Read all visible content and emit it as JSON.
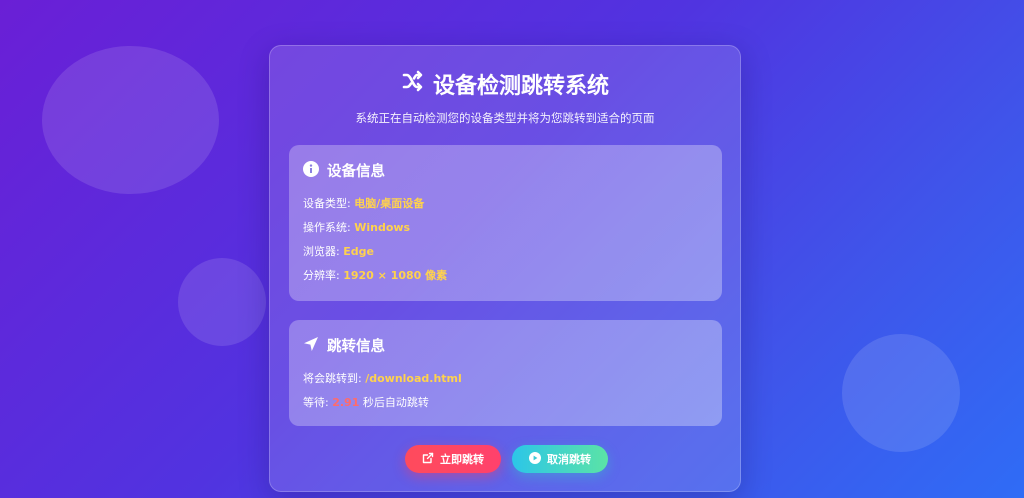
{
  "title": "设备检测跳转系统",
  "subtitle": "系统正在自动检测您的设备类型并将为您跳转到适合的页面",
  "device_panel": {
    "heading": "设备信息",
    "icon": "info-icon",
    "rows": [
      {
        "label": "设备类型:",
        "value": "电脑/桌面设备"
      },
      {
        "label": "操作系统:",
        "value": "Windows"
      },
      {
        "label": "浏览器:",
        "value": "Edge"
      },
      {
        "label": "分辨率:",
        "value": "1920 × 1080 像素"
      }
    ]
  },
  "redirect_panel": {
    "heading": "跳转信息",
    "icon": "location-arrow-icon",
    "target_label": "将会跳转到:",
    "target_value": "/download.html",
    "wait_label": "等待:",
    "wait_value": "2.91",
    "wait_suffix": "秒后自动跳转"
  },
  "buttons": {
    "go_label": "立即跳转",
    "cancel_label": "取消跳转"
  },
  "colors": {
    "accent_yellow": "#ffd24d",
    "countdown_red": "#ff6b6b",
    "go_button": "#ff4b5c",
    "cancel_button": "#2cc6e8"
  }
}
